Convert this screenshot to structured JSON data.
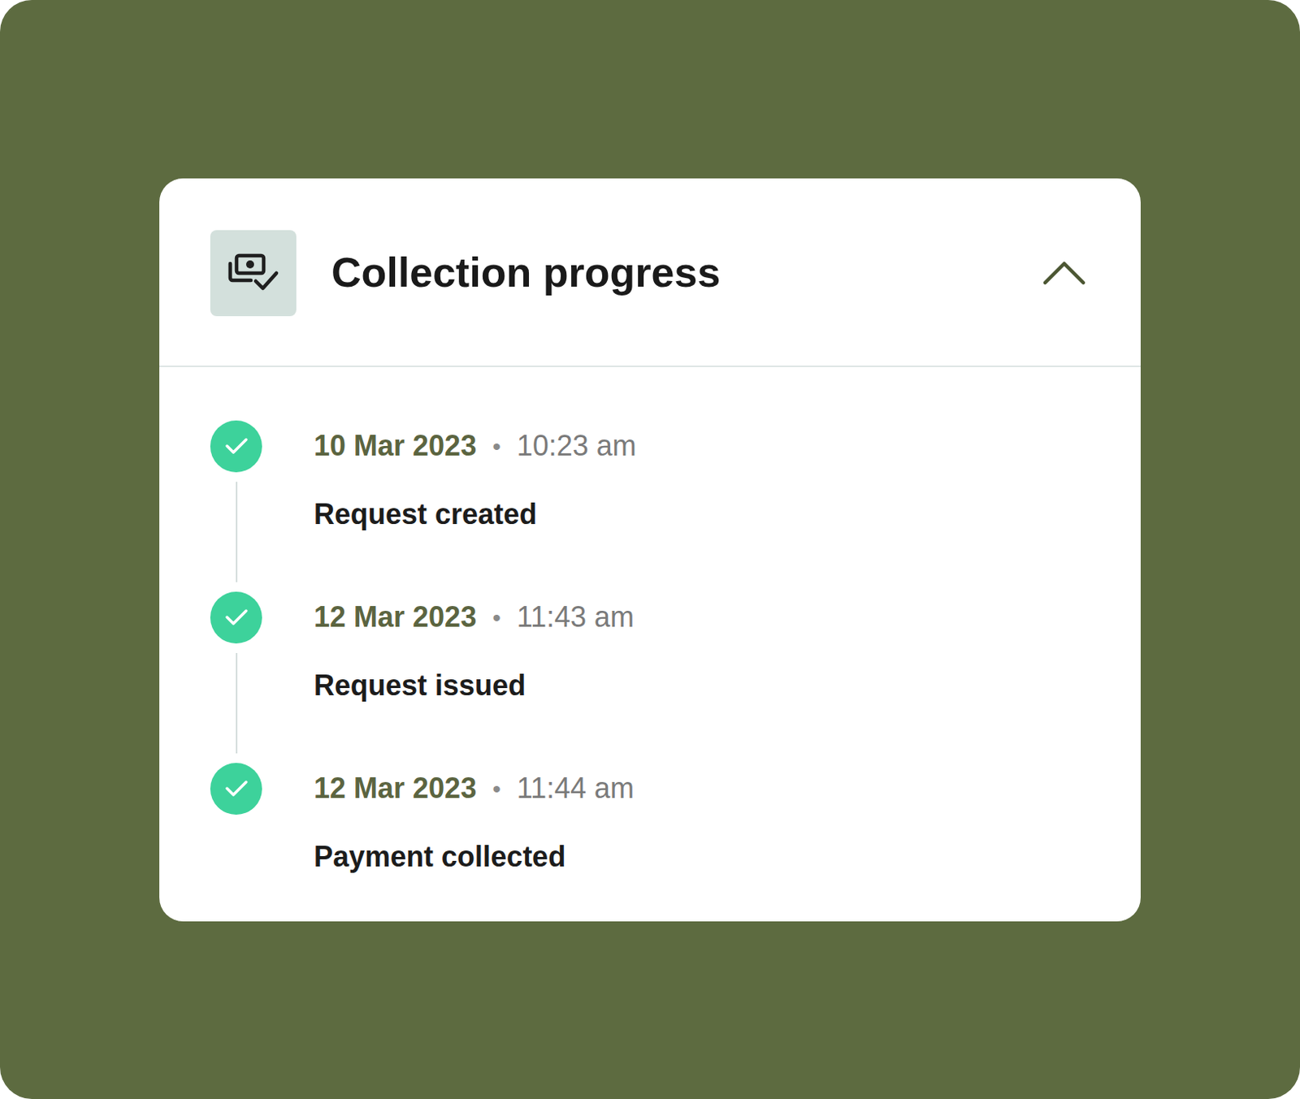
{
  "panel": {
    "title": "Collection progress",
    "expanded": true
  },
  "events": [
    {
      "date": "10 Mar 2023",
      "separator": "•",
      "time": "10:23 am",
      "label": "Request created",
      "completed": true
    },
    {
      "date": "12 Mar 2023",
      "separator": "•",
      "time": "11:43 am",
      "label": "Request issued",
      "completed": true
    },
    {
      "date": "12 Mar 2023",
      "separator": "•",
      "time": "11:44 am",
      "label": "Payment collected",
      "completed": true
    }
  ]
}
